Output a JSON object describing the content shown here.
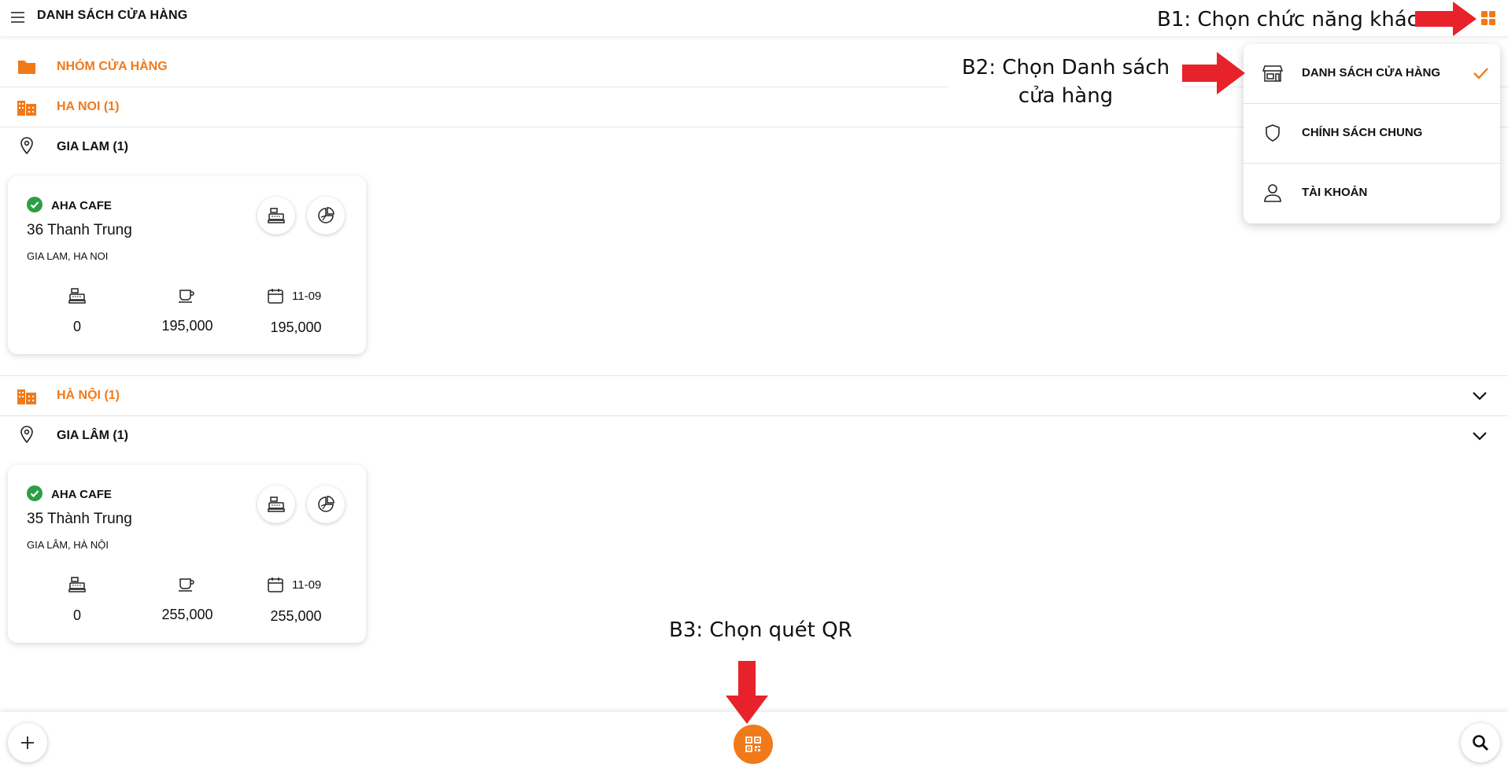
{
  "header": {
    "title": "DANH SÁCH CỬA HÀNG",
    "menu_icon": "hamburger-icon",
    "apps_icon": "grid-apps-icon"
  },
  "colors": {
    "accent": "#f07a1a",
    "success": "#2e9e44",
    "arrow": "#e8222a"
  },
  "groups_header": {
    "label": "NHÓM CỬA HÀNG",
    "icon": "folder-icon"
  },
  "sections": [
    {
      "city": "HA NOI (1)",
      "district": "GIA LAM (1)",
      "store": {
        "name": "AHA CAFE",
        "address": "36 Thanh Trung",
        "region": "GIA LAM, HA NOI",
        "stat_register": "0",
        "stat_sales": "195,000",
        "date": "11-09",
        "stat_date": "195,000"
      }
    },
    {
      "city": "HÀ NỘI (1)",
      "district": "GIA LÂM (1)",
      "store": {
        "name": "AHA CAFE",
        "address": "35 Thành Trung",
        "region": "GIA LÂM, HÀ NỘI",
        "stat_register": "0",
        "stat_sales": "255,000",
        "date": "11-09",
        "stat_date": "255,000"
      }
    }
  ],
  "menu": {
    "items": [
      {
        "label": "DANH SÁCH CỬA HÀNG",
        "icon": "store-icon",
        "selected": true
      },
      {
        "label": "CHÍNH SÁCH CHUNG",
        "icon": "shield-icon",
        "selected": false
      },
      {
        "label": "TÀI KHOẢN",
        "icon": "user-icon",
        "selected": false
      }
    ]
  },
  "annotations": {
    "b1": "B1: Chọn chức năng khác",
    "b2_line1": "B2: Chọn Danh sách",
    "b2_line2": "cửa hàng",
    "b3": "B3: Chọn quét QR"
  },
  "bottom_bar": {
    "add_icon": "plus-icon",
    "qr_icon": "qr-scan-icon",
    "search_icon": "search-icon"
  }
}
